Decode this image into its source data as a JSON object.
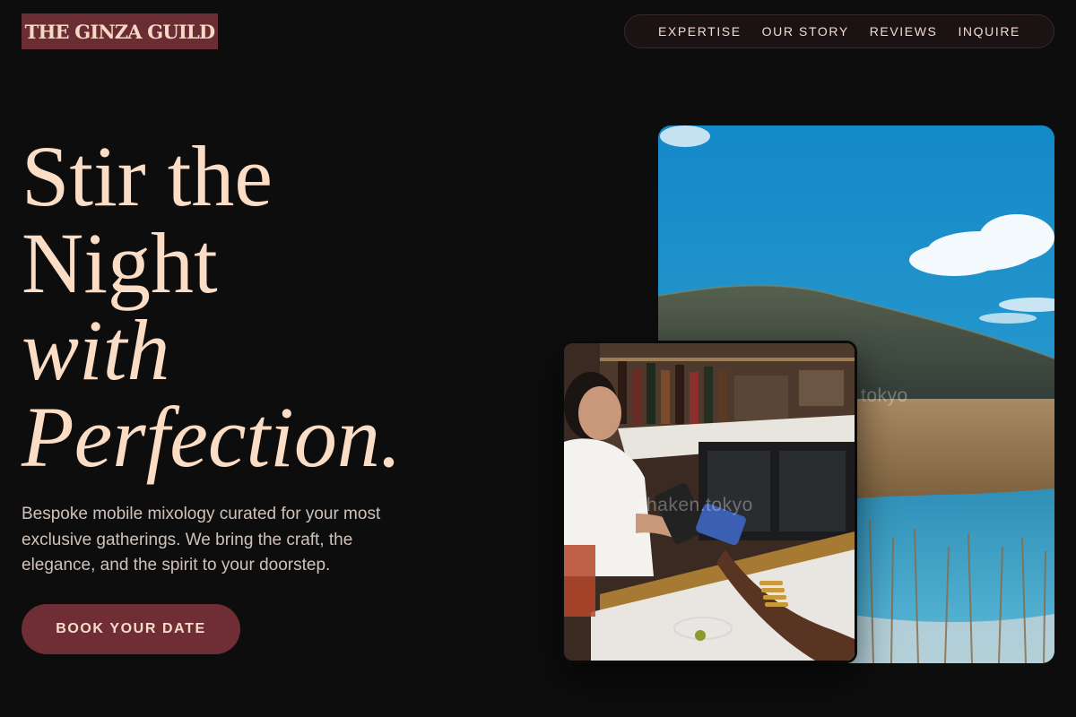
{
  "brand": {
    "logo_text": "THE GINZA GUILD"
  },
  "nav": {
    "items": [
      {
        "label": "EXPERTISE"
      },
      {
        "label": "OUR STORY"
      },
      {
        "label": "REVIEWS"
      },
      {
        "label": "INQUIRE"
      }
    ]
  },
  "hero": {
    "headline": {
      "line1": "Stir the",
      "line2": "Night",
      "line3": "with",
      "line4": "Perfection."
    },
    "subcopy": "Bespoke mobile mixology curated for your most exclusive gatherings. We bring the craft, the elegance, and the spirit to your doorstep.",
    "cta_label": "BOOK YOUR DATE"
  },
  "images": {
    "landscape_watermark": "tokyo",
    "bar_watermark": "shaken.tokyo"
  },
  "colors": {
    "background": "#0e0d0d",
    "accent": "#6f2e35",
    "headline": "#fbdcc4"
  }
}
